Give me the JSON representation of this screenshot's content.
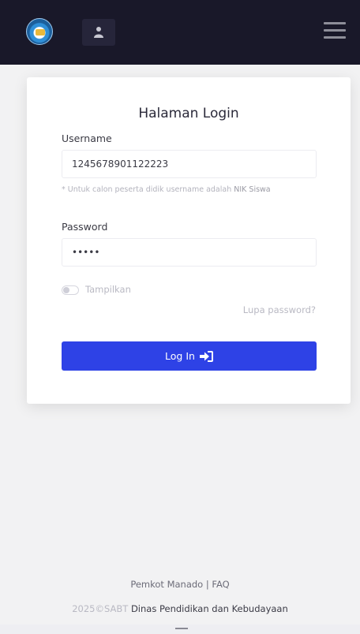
{
  "navbar": {
    "logo_icon": "tut-wuri-handayani-logo",
    "user_icon": "user-icon",
    "menu_icon": "hamburger-menu-icon",
    "background": "#191829"
  },
  "login": {
    "title": "Halaman Login",
    "username_label": "Username",
    "username_value": "1245678901122223",
    "hint_prefix": "* Untuk calon peserta didik username adalah ",
    "hint_bold": "NIK Siswa",
    "password_label": "Password",
    "password_value": "•••••",
    "show_password_label": "Tampilkan",
    "forgot_password": "Lupa password?",
    "login_button": "Log In",
    "login_icon": "sign-in-icon",
    "button_color": "#2e42e6"
  },
  "footer": {
    "link_1": "Pemkot Manado",
    "separator": "|",
    "link_2": "FAQ",
    "year": "2025©SABT",
    "org": "Dinas Pendidikan dan Kebudayaan"
  }
}
